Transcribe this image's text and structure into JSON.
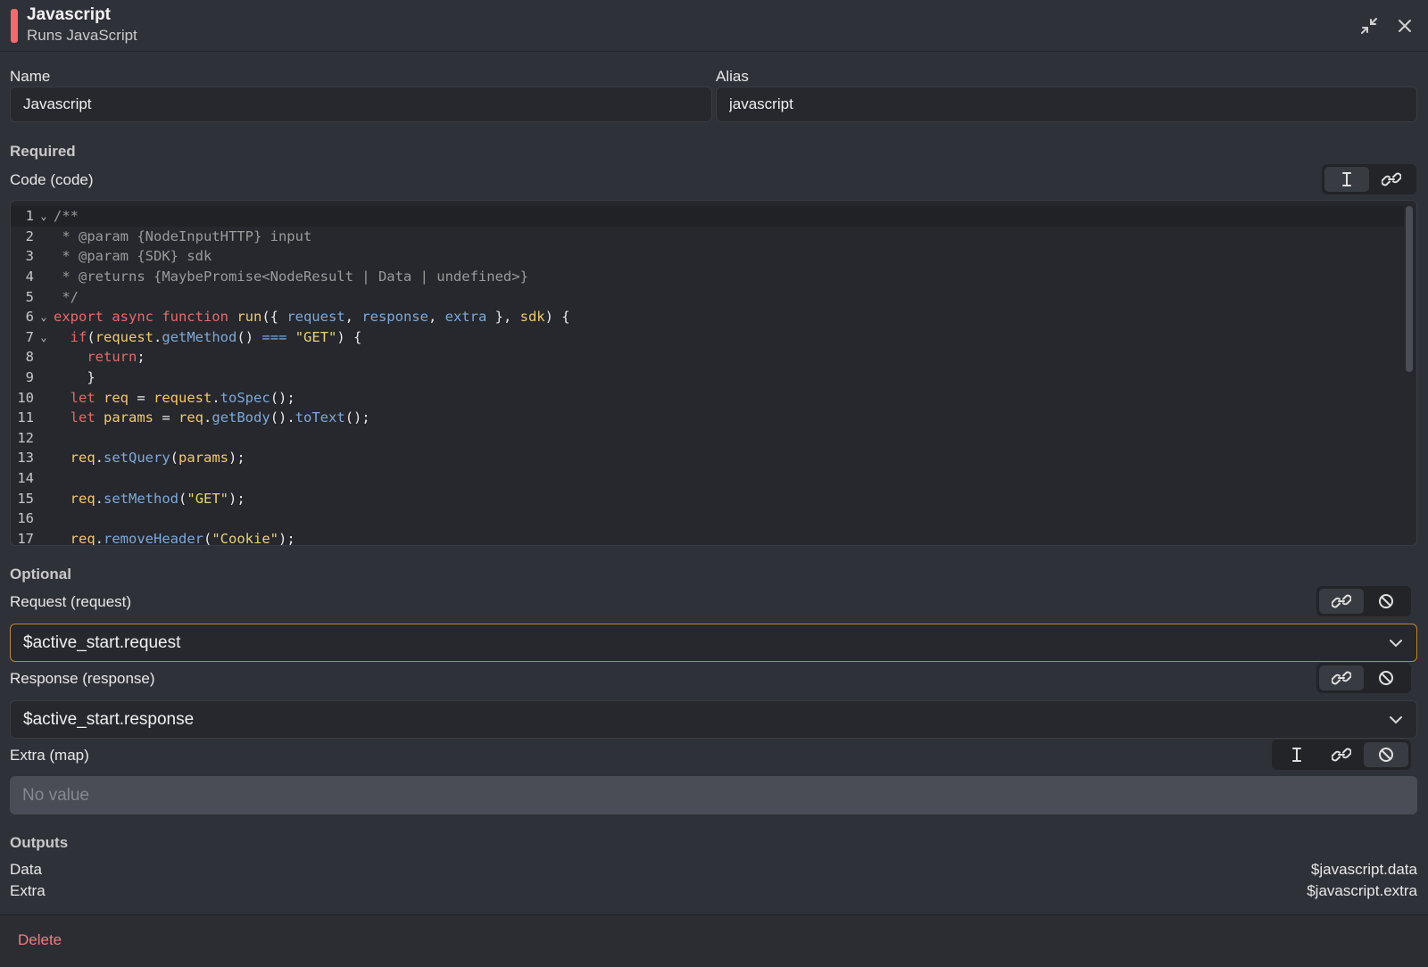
{
  "header": {
    "title": "Javascript",
    "subtitle": "Runs JavaScript",
    "accent_color": "#f06b6b"
  },
  "fields": {
    "name_label": "Name",
    "name_value": "Javascript",
    "alias_label": "Alias",
    "alias_value": "javascript"
  },
  "required": {
    "section_label": "Required",
    "code_label": "Code (code)"
  },
  "code": {
    "lines": [
      {
        "n": "1",
        "fold": "⌄",
        "tokens": [
          [
            "t-comment",
            "/**"
          ]
        ]
      },
      {
        "n": "2",
        "fold": "",
        "tokens": [
          [
            "t-comment",
            " * @param {NodeInputHTTP} input"
          ]
        ]
      },
      {
        "n": "3",
        "fold": "",
        "tokens": [
          [
            "t-comment",
            " * @param {SDK} sdk"
          ]
        ]
      },
      {
        "n": "4",
        "fold": "",
        "tokens": [
          [
            "t-comment",
            " * @returns {MaybePromise<NodeResult | Data | undefined>}"
          ]
        ]
      },
      {
        "n": "5",
        "fold": "",
        "tokens": [
          [
            "t-comment",
            " */"
          ]
        ]
      },
      {
        "n": "6",
        "fold": "⌄",
        "tokens": [
          [
            "t-kw",
            "export async function "
          ],
          [
            "t-fn",
            "run"
          ],
          [
            "t-plain",
            "({ "
          ],
          [
            "t-param",
            "request"
          ],
          [
            "t-plain",
            ", "
          ],
          [
            "t-param",
            "response"
          ],
          [
            "t-plain",
            ", "
          ],
          [
            "t-param",
            "extra"
          ],
          [
            "t-plain",
            " }, "
          ],
          [
            "t-var",
            "sdk"
          ],
          [
            "t-plain",
            ") {"
          ]
        ]
      },
      {
        "n": "7",
        "fold": "⌄",
        "tokens": [
          [
            "t-plain",
            "  "
          ],
          [
            "t-kw",
            "if"
          ],
          [
            "t-plain",
            "("
          ],
          [
            "t-var",
            "request"
          ],
          [
            "t-plain",
            "."
          ],
          [
            "t-method",
            "getMethod"
          ],
          [
            "t-plain",
            "() "
          ],
          [
            "t-param",
            "==="
          ],
          [
            "t-plain",
            " "
          ],
          [
            "t-str",
            "\"GET\""
          ],
          [
            "t-plain",
            ") {"
          ]
        ]
      },
      {
        "n": "8",
        "fold": "",
        "tokens": [
          [
            "t-plain",
            "    "
          ],
          [
            "t-kw",
            "return"
          ],
          [
            "t-plain",
            ";"
          ]
        ]
      },
      {
        "n": "9",
        "fold": "",
        "tokens": [
          [
            "t-plain",
            "    }"
          ]
        ]
      },
      {
        "n": "10",
        "fold": "",
        "tokens": [
          [
            "t-plain",
            "  "
          ],
          [
            "t-kw",
            "let"
          ],
          [
            "t-plain",
            " "
          ],
          [
            "t-var",
            "req"
          ],
          [
            "t-plain",
            " = "
          ],
          [
            "t-var",
            "request"
          ],
          [
            "t-plain",
            "."
          ],
          [
            "t-method",
            "toSpec"
          ],
          [
            "t-plain",
            "();"
          ]
        ]
      },
      {
        "n": "11",
        "fold": "",
        "tokens": [
          [
            "t-plain",
            "  "
          ],
          [
            "t-kw",
            "let"
          ],
          [
            "t-plain",
            " "
          ],
          [
            "t-var",
            "params"
          ],
          [
            "t-plain",
            " = "
          ],
          [
            "t-var",
            "req"
          ],
          [
            "t-plain",
            "."
          ],
          [
            "t-method",
            "getBody"
          ],
          [
            "t-plain",
            "()."
          ],
          [
            "t-method",
            "toText"
          ],
          [
            "t-plain",
            "();"
          ]
        ]
      },
      {
        "n": "12",
        "fold": "",
        "tokens": [
          [
            "t-plain",
            ""
          ]
        ]
      },
      {
        "n": "13",
        "fold": "",
        "tokens": [
          [
            "t-plain",
            "  "
          ],
          [
            "t-var",
            "req"
          ],
          [
            "t-plain",
            "."
          ],
          [
            "t-method",
            "setQuery"
          ],
          [
            "t-plain",
            "("
          ],
          [
            "t-var",
            "params"
          ],
          [
            "t-plain",
            ");"
          ]
        ]
      },
      {
        "n": "14",
        "fold": "",
        "tokens": [
          [
            "t-plain",
            ""
          ]
        ]
      },
      {
        "n": "15",
        "fold": "",
        "tokens": [
          [
            "t-plain",
            "  "
          ],
          [
            "t-var",
            "req"
          ],
          [
            "t-plain",
            "."
          ],
          [
            "t-method",
            "setMethod"
          ],
          [
            "t-plain",
            "("
          ],
          [
            "t-str",
            "\"GET\""
          ],
          [
            "t-plain",
            ");"
          ]
        ]
      },
      {
        "n": "16",
        "fold": "",
        "tokens": [
          [
            "t-plain",
            ""
          ]
        ]
      },
      {
        "n": "17",
        "fold": "",
        "tokens": [
          [
            "t-plain",
            "  "
          ],
          [
            "t-var",
            "req"
          ],
          [
            "t-plain",
            "."
          ],
          [
            "t-method",
            "removeHeader"
          ],
          [
            "t-plain",
            "("
          ],
          [
            "t-str",
            "\"Cookie\""
          ],
          [
            "t-plain",
            ");"
          ]
        ]
      }
    ]
  },
  "optional": {
    "section_label": "Optional",
    "request_label": "Request (request)",
    "request_value": "$active_start.request",
    "response_label": "Response (response)",
    "response_value": "$active_start.response",
    "extra_label": "Extra (map)",
    "extra_placeholder": "No value"
  },
  "outputs": {
    "section_label": "Outputs",
    "items": [
      {
        "key": "Data",
        "value": "$javascript.data"
      },
      {
        "key": "Extra",
        "value": "$javascript.extra"
      }
    ]
  },
  "footer": {
    "delete_label": "Delete"
  }
}
